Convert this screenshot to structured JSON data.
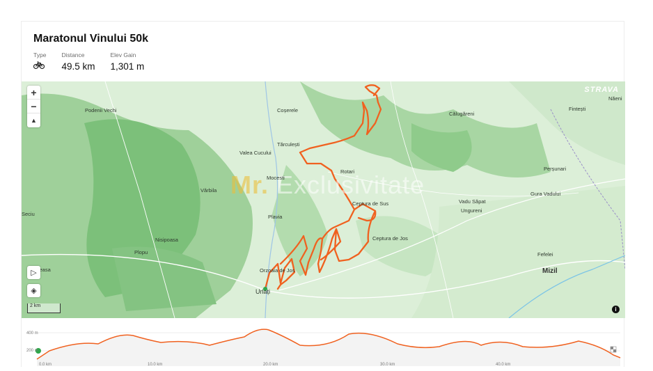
{
  "activity": {
    "title": "Maratonul Vinului 50k",
    "type_label": "Type",
    "type_icon": "bicycle-icon",
    "distance_label": "Distance",
    "distance_value": "49.5 km",
    "elev_label": "Elev Gain",
    "elev_value": "1,301 m"
  },
  "map": {
    "brand": "STRAVA",
    "scale_label": "2 km",
    "watermark_a": "Mr.",
    "watermark_b": " Exclusivitate",
    "route_color": "#f0611f",
    "places": [
      {
        "name": "Podenii Vechi"
      },
      {
        "name": "Coșerele"
      },
      {
        "name": "Călugăreni"
      },
      {
        "name": "Fintești"
      },
      {
        "name": "Năeni"
      },
      {
        "name": "Tărculești"
      },
      {
        "name": "Valea Cucului"
      },
      {
        "name": "Rotari"
      },
      {
        "name": "Perșunari"
      },
      {
        "name": "Mocesti"
      },
      {
        "name": "Vărbila"
      },
      {
        "name": "Gura Vadului"
      },
      {
        "name": "Vadu Săpat"
      },
      {
        "name": "Ceptura de Sus"
      },
      {
        "name": "Ungureni"
      },
      {
        "name": "Seciu"
      },
      {
        "name": "Plavia"
      },
      {
        "name": "Nisipoasa"
      },
      {
        "name": "Ceptura de Jos"
      },
      {
        "name": "Plopu"
      },
      {
        "name": "Fefelei"
      },
      {
        "name": "Mizil"
      },
      {
        "name": "Oleasa"
      },
      {
        "name": "Orzoaia de Jos"
      },
      {
        "name": "Urlați"
      }
    ],
    "controls": {
      "zoom_in": "+",
      "zoom_out": "−",
      "compass": "▲",
      "play": "▷",
      "layers": "◈",
      "info": "i"
    }
  },
  "elevation": {
    "y_ticks": [
      "400 m",
      "200 m"
    ],
    "x_ticks": [
      "0.0 km",
      "10.0 km",
      "20.0 km",
      "30.0 km",
      "40.0 km"
    ]
  }
}
